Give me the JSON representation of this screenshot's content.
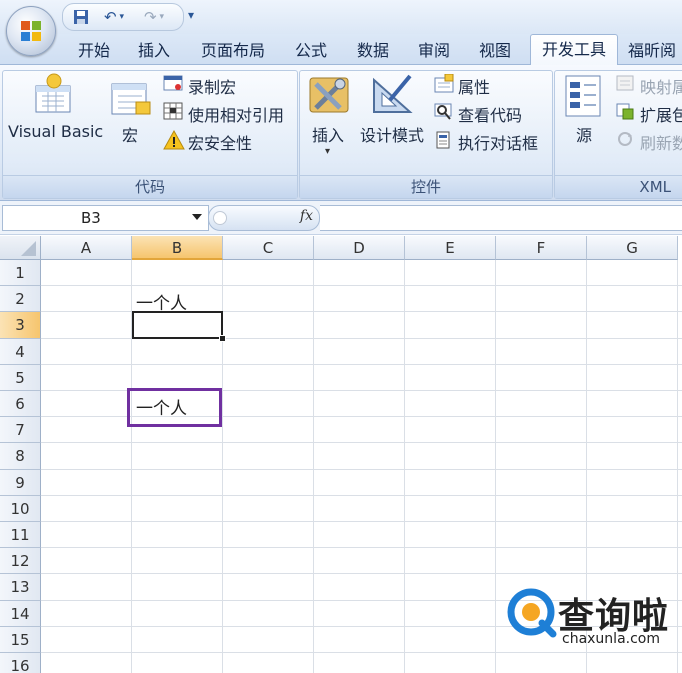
{
  "qat": {
    "save": "save-icon",
    "undo": "undo-icon",
    "redo": "redo-icon",
    "customize": "customize-icon"
  },
  "tabs": [
    "开始",
    "插入",
    "页面布局",
    "公式",
    "数据",
    "审阅",
    "视图",
    "开发工具",
    "福昕阅"
  ],
  "active_tab": "开发工具",
  "ribbon": {
    "code": {
      "label": "代码",
      "visual_basic": "Visual Basic",
      "macros": "宏",
      "record_macro": "录制宏",
      "relative_ref": "使用相对引用",
      "macro_security": "宏安全性"
    },
    "controls": {
      "label": "控件",
      "insert": "插入",
      "design_mode": "设计模式",
      "properties": "属性",
      "view_code": "查看代码",
      "run_dialog": "执行对话框"
    },
    "xml": {
      "label": "XML",
      "source": "源",
      "map_props": "映射属",
      "expansion": "扩展包",
      "refresh": "刷新数"
    }
  },
  "formula_bar": {
    "name_box": "B3",
    "fx": "fx",
    "value": ""
  },
  "columns": [
    "A",
    "B",
    "C",
    "D",
    "E",
    "F",
    "G"
  ],
  "rows": [
    "1",
    "2",
    "3",
    "4",
    "5",
    "6",
    "7",
    "8",
    "9",
    "10",
    "11",
    "12",
    "13",
    "14",
    "15",
    "16"
  ],
  "cells": {
    "B2": "一个人",
    "B6": "一个人"
  },
  "selected_cell": "B3",
  "highlight_color": "#7030a0",
  "watermark": {
    "brand": "查询啦",
    "url": "chaxunla.com"
  }
}
